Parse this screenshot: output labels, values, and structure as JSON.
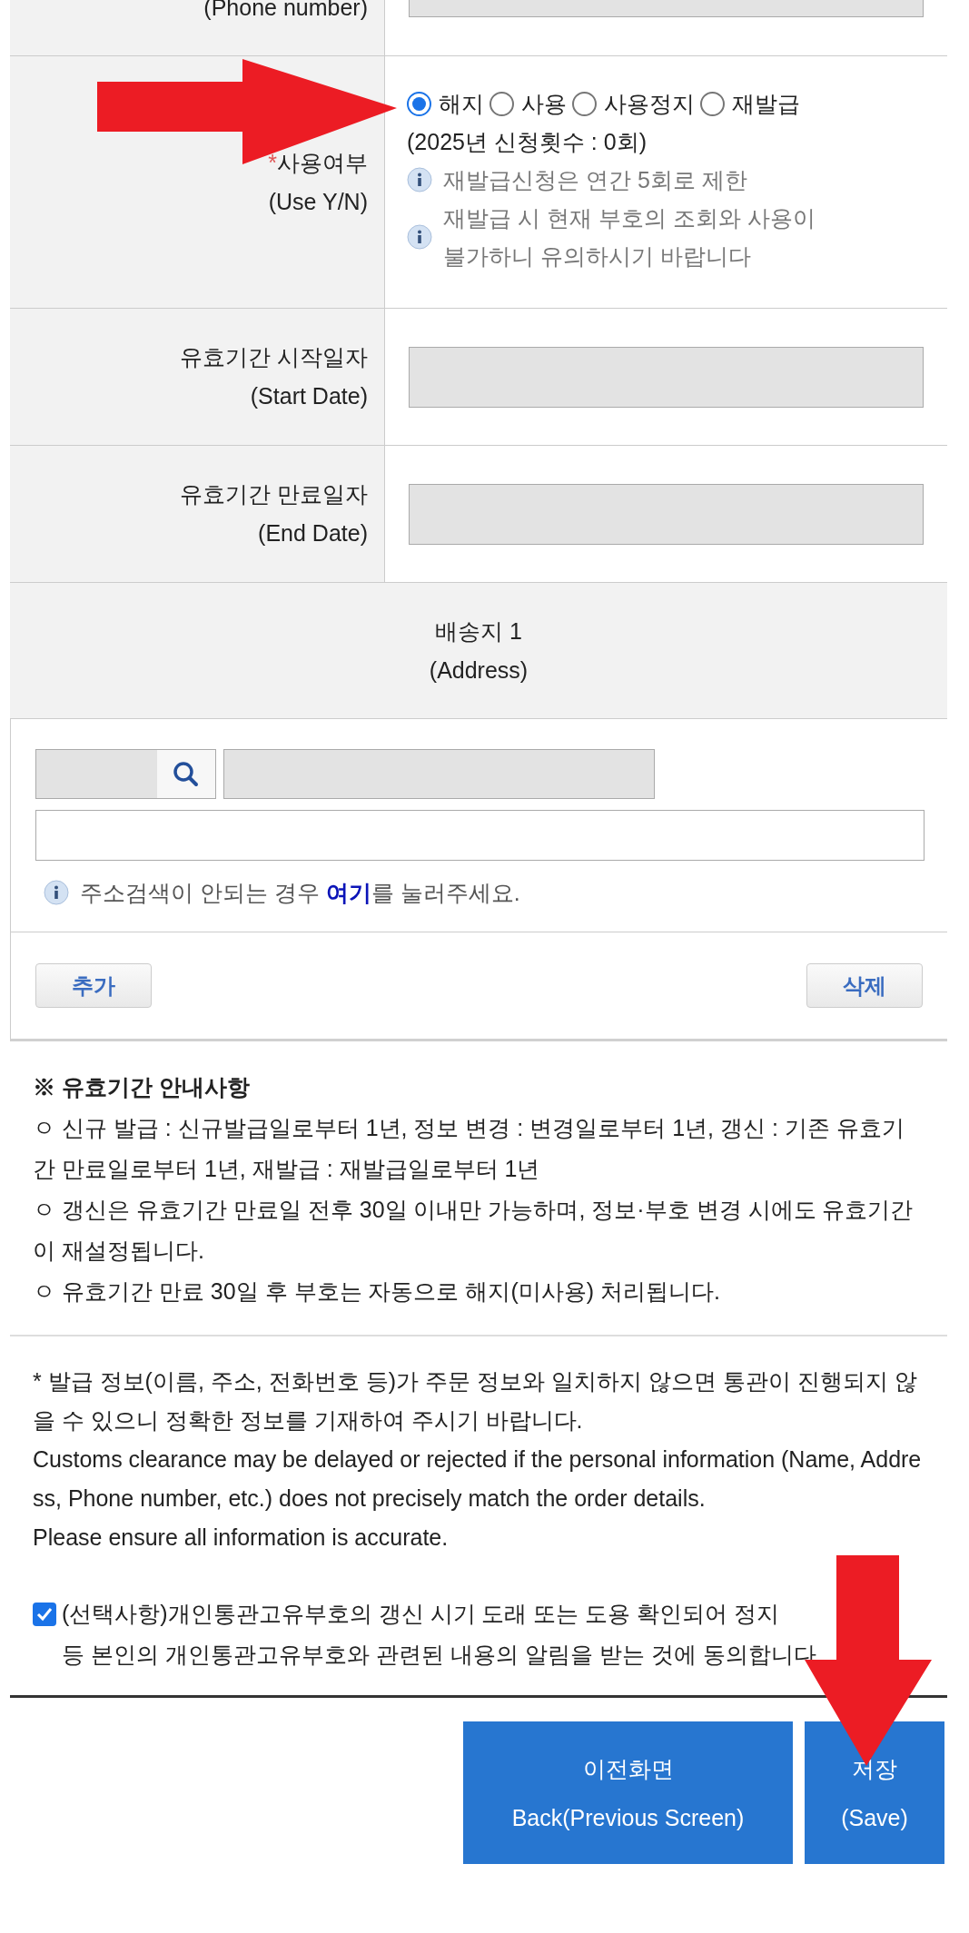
{
  "rows": [
    {
      "kind": "partial_field",
      "label": "(Phone number)",
      "field": {
        "disabled": true
      }
    },
    {
      "kind": "radio_group",
      "required_mark": "*",
      "annotation_arrow": true,
      "label": "사용여부",
      "sublabel": "(Use Y/N)",
      "options": [
        {
          "label": "해지",
          "selected": true
        },
        {
          "label": "사용",
          "selected": false
        },
        {
          "label": "사용정지",
          "selected": false
        },
        {
          "label": "재발급",
          "selected": false
        }
      ],
      "count_text": "(2025년 신청횟수 : 0회)",
      "notes": [
        {
          "lines": [
            "재발급신청은 연간 5회로 제한"
          ]
        },
        {
          "lines": [
            "재발급 시 현재 부호의 조회와 사용이",
            "불가하니 유의하시기 바랍니다"
          ]
        }
      ]
    },
    {
      "kind": "field",
      "label": "유효기간 시작일자",
      "sublabel": "(Start Date)",
      "field": {
        "disabled": true
      }
    },
    {
      "kind": "field",
      "label": "유효기간 만료일자",
      "sublabel": "(End Date)",
      "field": {
        "disabled": true
      }
    }
  ],
  "address": {
    "title": "배송지 1",
    "subtitle": "(Address)",
    "zip_field": {
      "disabled": true
    },
    "address_field": {
      "disabled": true
    },
    "detail_field": {
      "disabled": false
    },
    "hint_before": "주소검색이 안되는 경우 ",
    "hint_link": "여기",
    "hint_after": "를 눌러주세요.",
    "add_button": "추가",
    "delete_button": "삭제"
  },
  "validity_notice": {
    "title": "※ 유효기간 안내사항",
    "items": [
      "ㅇ 신규 발급 : 신규발급일로부터 1년, 정보 변경 : 변경일로부터 1년, 갱신 : 기존 유효기간 만료일로부터 1년, 재발급 : 재발급일로부터 1년",
      "ㅇ 갱신은 유효기간 만료일 전후 30일 이내만 가능하며, 정보·부호 변경 시에도 유효기간이 재설정됩니다.",
      "ㅇ 유효기간 만료 30일 후 부호는 자동으로 해지(미사용) 처리됩니다."
    ]
  },
  "disclaimer": {
    "korean": "* 발급 정보(이름, 주소, 전화번호 등)가 주문 정보와 일치하지 않으면 통관이 진행되지 않을 수 있으니 정확한 정보를 기재하여 주시기 바랍니다.",
    "english": [
      "Customs clearance may be delayed or rejected if the personal information (Name, Address, Phone number, etc.) does not precisely match the order details.",
      "Please ensure all information is accurate."
    ]
  },
  "consent": {
    "checked": true,
    "lines": [
      "(선택사항)개인통관고유부호의 갱신 시기 도래 또는 도용 확인되어 정지",
      "등 본인의 개인통관고유부호와 관련된 내용의 알림을 받는 것에 동의합니다."
    ]
  },
  "footer_buttons": [
    {
      "kind": "back",
      "annotation_arrow": false,
      "lines": [
        "이전화면",
        "Back(Previous Screen)"
      ]
    },
    {
      "kind": "save",
      "annotation_arrow": true,
      "lines": [
        "저장",
        "(Save)"
      ]
    }
  ]
}
